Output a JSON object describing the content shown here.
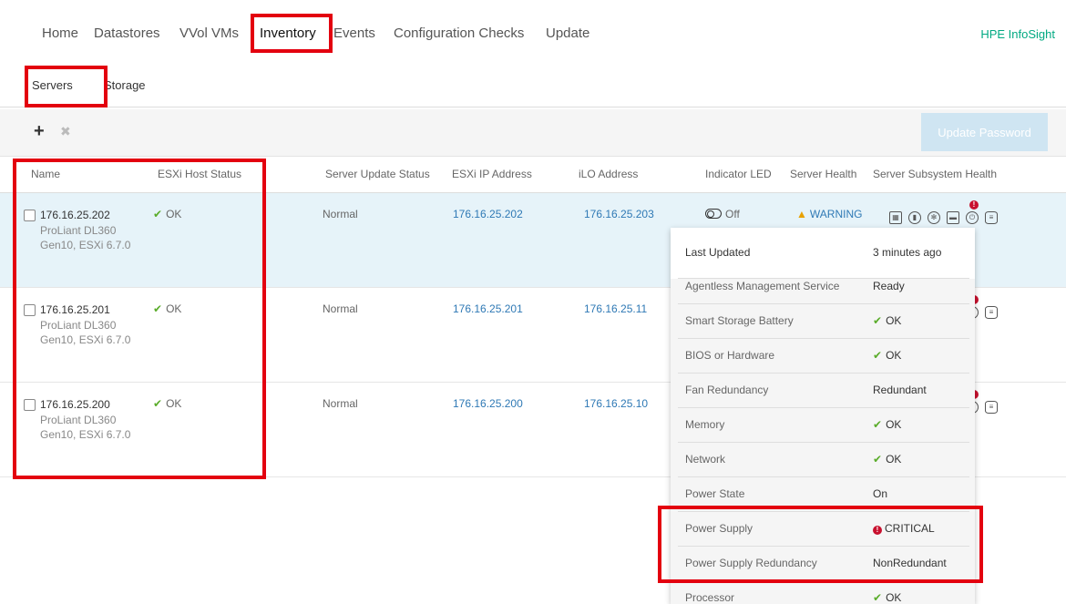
{
  "topnav": {
    "items": [
      "Home",
      "Datastores",
      "VVol VMs",
      "Inventory",
      "Events",
      "Configuration Checks",
      "Update"
    ],
    "brand": "HPE InfoSight"
  },
  "subnav": {
    "tabs": [
      "Servers",
      "Storage"
    ]
  },
  "toolbar": {
    "add_icon": "+",
    "delete_icon": "✖",
    "update_password": "Update Password"
  },
  "table": {
    "columns": [
      "Name",
      "ESXi Host Status",
      "Server Update Status",
      "ESXi IP Address",
      "iLO Address",
      "Indicator LED",
      "Server Health",
      "Server Subsystem Health"
    ],
    "rows": [
      {
        "name": "176.16.25.202",
        "model": "ProLiant DL360 Gen10, ESXi 6.7.0",
        "esxi_status": "OK",
        "update_status": "Normal",
        "esxi_ip": "176.16.25.202",
        "ilo": "176.16.25.203",
        "led": "Off",
        "health": "WARNING"
      },
      {
        "name": "176.16.25.201",
        "model": "ProLiant DL360 Gen10, ESXi 6.7.0",
        "esxi_status": "OK",
        "update_status": "Normal",
        "esxi_ip": "176.16.25.201",
        "ilo": "176.16.25.11"
      },
      {
        "name": "176.16.25.200",
        "model": "ProLiant DL360 Gen10, ESXi 6.7.0",
        "esxi_status": "OK",
        "update_status": "Normal",
        "esxi_ip": "176.16.25.200",
        "ilo": "176.16.25.10"
      }
    ]
  },
  "popover": {
    "rows": [
      {
        "label": "Last Updated",
        "value": "3 minutes ago"
      },
      {
        "label": "Agentless Management Service",
        "value": "Ready"
      },
      {
        "label": "Smart Storage Battery",
        "value": "OK"
      },
      {
        "label": "BIOS or Hardware",
        "value": "OK"
      },
      {
        "label": "Fan Redundancy",
        "value": "Redundant"
      },
      {
        "label": "Memory",
        "value": "OK"
      },
      {
        "label": "Network",
        "value": "OK"
      },
      {
        "label": "Power State",
        "value": "On"
      },
      {
        "label": "Power Supply",
        "value": "CRITICAL"
      },
      {
        "label": "Power Supply Redundancy",
        "value": "NonRedundant"
      },
      {
        "label": "Processor",
        "value": "OK"
      }
    ]
  },
  "colors": {
    "accent": "#01a982",
    "link": "#2f79b5",
    "ok": "#5aac2a",
    "warning": "#e8a100",
    "critical": "#c8102e",
    "highlight": "#e3000f"
  },
  "icons": [
    "plus-icon",
    "close-icon",
    "check-icon",
    "toggle-icon",
    "warning-icon",
    "chip-icon",
    "thermometer-icon",
    "fan-icon",
    "network-card-icon",
    "power-supply-icon",
    "storage-icon",
    "critical-icon"
  ]
}
